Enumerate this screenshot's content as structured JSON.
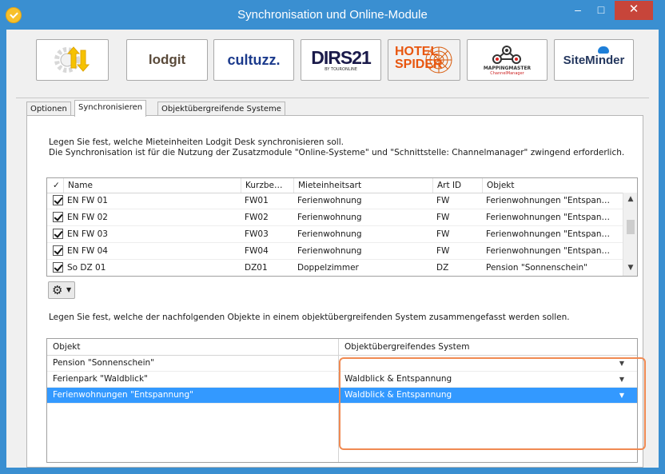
{
  "window": {
    "title": "Synchronisation und Online-Module",
    "minimize": "–",
    "maximize": "□",
    "close": "✕"
  },
  "logos": [
    {
      "name": "sync-module",
      "text": ""
    },
    {
      "name": "lodgit",
      "text": "lodgit"
    },
    {
      "name": "cultuzz",
      "text": "cultuzz."
    },
    {
      "name": "dirs21",
      "text": "DIRS21",
      "sub": "BY TOURONLINE"
    },
    {
      "name": "hotel-spider",
      "text": "HOTEL SPIDER"
    },
    {
      "name": "mapping-master",
      "text": "MAPPINGMASTER",
      "sub": "ChannelManager"
    },
    {
      "name": "siteminder",
      "text": "SiteMinder"
    }
  ],
  "tabs": [
    {
      "label": "Optionen",
      "active": false
    },
    {
      "label": "Synchronisieren",
      "active": true
    },
    {
      "label": "Objektübergreifende Systeme",
      "active": false
    }
  ],
  "intro": {
    "line1": "Legen Sie fest, welche Mieteinheiten Lodgit Desk synchronisieren soll.",
    "line2": "Die Synchronisation ist für die Nutzung der Zusatzmodule \"Online-Systeme\" und \"Schnittstelle: Channelmanager\" zwingend erforderlich."
  },
  "units_table": {
    "columns": [
      "✓",
      "Name",
      "Kurzbe…",
      "Mieteinheitsart",
      "Art ID",
      "Objekt"
    ],
    "rows": [
      {
        "name": "EN FW 01",
        "short": "FW01",
        "type": "Ferienwohnung",
        "art_id": "FW",
        "object": "Ferienwohnungen \"Entspan…"
      },
      {
        "name": "EN FW 02",
        "short": "FW02",
        "type": "Ferienwohnung",
        "art_id": "FW",
        "object": "Ferienwohnungen \"Entspan…"
      },
      {
        "name": "EN FW 03",
        "short": "FW03",
        "type": "Ferienwohnung",
        "art_id": "FW",
        "object": "Ferienwohnungen \"Entspan…"
      },
      {
        "name": "EN FW 04",
        "short": "FW04",
        "type": "Ferienwohnung",
        "art_id": "FW",
        "object": "Ferienwohnungen \"Entspan…"
      },
      {
        "name": "So DZ 01",
        "short": "DZ01",
        "type": "Doppelzimmer",
        "art_id": "DZ",
        "object": "Pension \"Sonnenschein\""
      }
    ]
  },
  "intro2": "Legen Sie fest, welche der nachfolgenden Objekte in einem objektübergreifenden System zusammengefasst werden sollen.",
  "objects_table": {
    "columns": [
      "Objekt",
      "Objektübergreifendes System"
    ],
    "rows": [
      {
        "object": "Pension \"Sonnenschein\"",
        "system": "",
        "selected": false
      },
      {
        "object": "Ferienpark \"Waldblick\"",
        "system": "Waldblick & Entspannung",
        "selected": false
      },
      {
        "object": "Ferienwohnungen \"Entspannung\"",
        "system": "Waldblick & Entspannung",
        "selected": true
      }
    ]
  },
  "colors": {
    "titlebar": "#3a8fd1",
    "close": "#c7453a",
    "selection": "#3399ff",
    "highlight": "#f08a52"
  }
}
